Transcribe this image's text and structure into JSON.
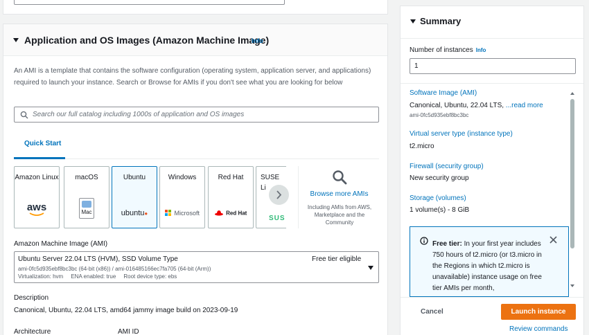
{
  "ami_section": {
    "title": "Application and OS Images (Amazon Machine Image)",
    "info_label": "Info",
    "description": "An AMI is a template that contains the software configuration (operating system, application server, and applications) required to launch your instance. Search or Browse for AMIs if you don't see what you are looking for below",
    "search_placeholder": "Search our full catalog including 1000s of application and OS images",
    "tab_label": "Quick Start",
    "os_cards": [
      {
        "label": "Amazon Linux",
        "logo_text": "aws"
      },
      {
        "label": "macOS",
        "logo_text": "Mac"
      },
      {
        "label": "Ubuntu",
        "logo_text": "ubuntu"
      },
      {
        "label": "Windows",
        "logo_text": "Microsoft"
      },
      {
        "label": "Red Hat",
        "logo_text": "Red Hat"
      },
      {
        "label": "SUSE Li",
        "logo_text": "SUS"
      }
    ],
    "selected_os": "Ubuntu",
    "browse_more_label": "Browse more AMIs",
    "browse_more_sub": "Including AMIs from AWS, Marketplace and the Community",
    "ami_select_label": "Amazon Machine Image (AMI)",
    "ami_select_name": "Ubuntu Server 22.04 LTS (HVM), SSD Volume Type",
    "ami_select_ids": "ami-0fc5d935ebf8bc3bc (64-bit (x86)) / ami-016485166ec7fa705 (64-bit (Arm))",
    "ami_select_virt": "Virtualization: hvm     ENA enabled: true     Root device type: ebs",
    "free_tier_eligible": "Free tier eligible",
    "description_label": "Description",
    "description_value": "Canonical, Ubuntu, 22.04 LTS, amd64 jammy image build on 2023-09-19",
    "architecture_label": "Architecture",
    "ami_id_label": "AMI ID"
  },
  "summary": {
    "title": "Summary",
    "instances_label": "Number of instances",
    "instances_info": "Info",
    "instances_value": "1",
    "software_image_label": "Software Image (AMI)",
    "software_image_value": "Canonical, Ubuntu, 22.04 LTS, ",
    "software_image_read_more": "...read more",
    "software_image_id": "ami-0fc5d935ebf8bc3bc",
    "instance_type_label": "Virtual server type (instance type)",
    "instance_type_value": "t2.micro",
    "firewall_label": "Firewall (security group)",
    "firewall_value": "New security group",
    "storage_label": "Storage (volumes)",
    "storage_value": "1 volume(s) - 8 GiB",
    "free_tier_title": "Free tier:",
    "free_tier_text": " In your first year includes 750 hours of t2.micro (or t3.micro in the Regions in which t2.micro is unavailable) instance usage on free tier AMIs per month,",
    "cancel_label": "Cancel",
    "launch_label": "Launch instance",
    "review_label": "Review commands"
  },
  "colors": {
    "link_blue": "#0073bb",
    "primary_orange": "#ec7211",
    "page_bg": "#f2f3f3"
  }
}
